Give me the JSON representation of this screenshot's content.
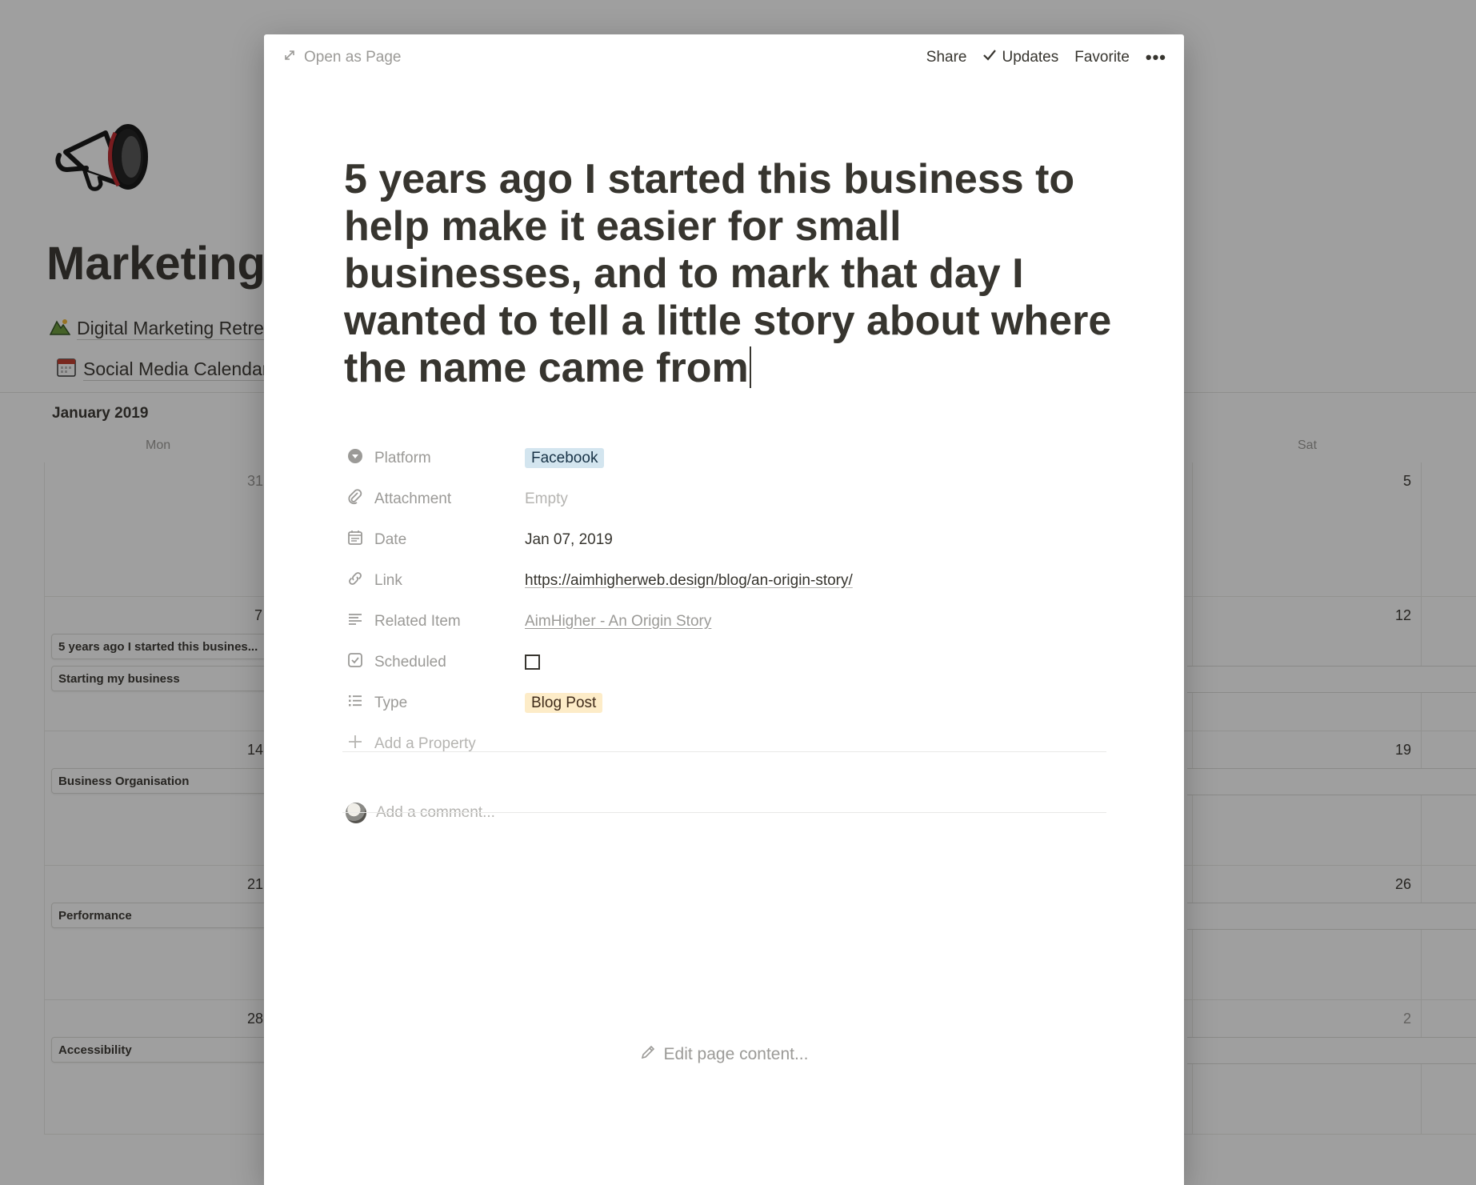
{
  "background": {
    "page_title": "Marketing",
    "linked_pages": [
      "Digital Marketing Retreat",
      "Social Media Calendar"
    ],
    "calendar": {
      "month": "January 2019",
      "weekdays": [
        "Mon",
        "Sat"
      ],
      "weeks": [
        {
          "mon": "31",
          "sat": "5",
          "events": []
        },
        {
          "mon": "7",
          "sat": "12",
          "events": [
            "5 years ago I started this busines...",
            "Starting my business"
          ]
        },
        {
          "mon": "14",
          "sat": "19",
          "events": [
            "Business Organisation"
          ]
        },
        {
          "mon": "21",
          "sat": "26",
          "events": [
            "Performance"
          ]
        },
        {
          "mon": "28",
          "sat": "2",
          "events": [
            "Accessibility"
          ]
        }
      ]
    }
  },
  "modal": {
    "open_as_page": "Open as Page",
    "actions": {
      "share": "Share",
      "updates": "Updates",
      "favorite": "Favorite",
      "more": "•••"
    },
    "title": "5 years ago I started this business to help make it easier for small businesses, and to mark that day I wanted to tell a little story about where the name came from",
    "properties": {
      "platform": {
        "label": "Platform",
        "value": "Facebook"
      },
      "attachment": {
        "label": "Attachment",
        "value": "Empty"
      },
      "date": {
        "label": "Date",
        "value": "Jan 07, 2019"
      },
      "link": {
        "label": "Link",
        "value": "https://aimhigherweb.design/blog/an-origin-story/"
      },
      "related": {
        "label": "Related Item",
        "value": "AimHigher - An Origin Story"
      },
      "scheduled": {
        "label": "Scheduled",
        "checked": false
      },
      "type": {
        "label": "Type",
        "value": "Blog Post"
      },
      "add_property": "Add a Property"
    },
    "comment_placeholder": "Add a comment...",
    "edit_content": "Edit page content..."
  },
  "colors": {
    "tag_blue": "#d3e5ef",
    "tag_yellow": "#fdecc8",
    "overlay": "rgba(15,15,15,0.4)"
  }
}
